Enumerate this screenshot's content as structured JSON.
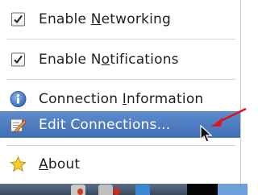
{
  "menu": {
    "items": [
      {
        "label_pre": "Enable ",
        "label_ul": "N",
        "label_post": "etworking",
        "icon": "checkbox-checked-icon",
        "checked": true
      },
      {
        "label_pre": "Enable N",
        "label_ul": "o",
        "label_post": "tifications",
        "icon": "checkbox-checked-icon",
        "checked": true
      },
      {
        "label_pre": "Connection ",
        "label_ul": "I",
        "label_post": "nformation",
        "icon": "info-icon"
      },
      {
        "label_pre": "Edit Connections...",
        "label_ul": "",
        "label_post": "",
        "icon": "edit-pencil-icon",
        "highlighted": true
      },
      {
        "label_pre": "",
        "label_ul": "A",
        "label_post": "bout",
        "icon": "star-icon"
      }
    ]
  },
  "colors": {
    "highlight": "#4a7cc0",
    "arrow": "#e0141a",
    "info_icon": "#3f74c4",
    "star": "#f5cf2b"
  }
}
